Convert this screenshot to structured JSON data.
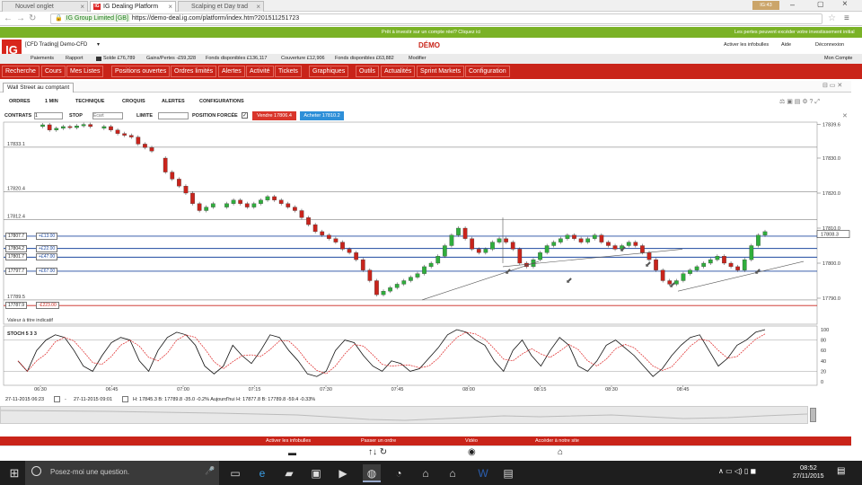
{
  "browser": {
    "tabs": [
      {
        "label": "Nouvel onglet",
        "active": false
      },
      {
        "label": "IG Dealing Platform",
        "active": true
      },
      {
        "label": "Scalping et Day trad",
        "active": false
      }
    ],
    "url": "https://demo-deal.ig.com/platform/index.htm?201511251723",
    "site_badge": "IG Group Limited [GB]",
    "user_badge": "IG:43"
  },
  "green_bar": {
    "center": "Prêt à investir sur un compte réel? Cliquez ici",
    "right": "Les pertes peuvent excéder votre investissement initial"
  },
  "header": {
    "account": "[CFD Trading] Demo-CFD",
    "mode": "DÉMO",
    "links": [
      "Activer les infobulles",
      "Aide",
      "Déconnexion"
    ]
  },
  "account_bar": {
    "items": [
      "Paiements",
      "Rapport"
    ],
    "balance": "Solde £76,789",
    "pnl": "Gains/Pertes -£59,328",
    "funds": "Fonds disponibles £136,117",
    "margin": "Couverture £12,906",
    "available": "Fonds disponibles £63,882",
    "modify": "Modifier",
    "my_account": "Mon Compte"
  },
  "menu": [
    "Recherche",
    "Cours",
    "Mes Listes",
    "Positions ouvertes",
    "Ordres limités",
    "Alertes",
    "Activité",
    "Tickets",
    "Graphiques",
    "Outils",
    "Actualités",
    "Sprint Markets",
    "Configuration"
  ],
  "window": {
    "title": "Wall Street au comptant"
  },
  "toolbar": {
    "items": [
      "ORDRES",
      "1 MIN",
      "TECHNIQUE",
      "CROQUIS",
      "ALERTES",
      "CONFIGURATIONS"
    ],
    "contracts_label": "CONTRATS",
    "contracts_value": "1",
    "stop_label": "STOP",
    "stop_placeholder": "Ecart",
    "limit_label": "LIMITE",
    "forced_label": "POSITION FORCÉE",
    "sell": "Vendre 17806.4",
    "buy": "Acheter 17810.2"
  },
  "chart": {
    "price_ticks": [
      "17839.6",
      "17830.0",
      "17820.0",
      "17810.0",
      "17808.3",
      "17800.0",
      "17790.0"
    ],
    "left_levels": [
      "17833.1",
      "17820.4",
      "17812.4",
      "17789.5"
    ],
    "positions": [
      {
        "price": "17807.7",
        "pnl": "+£13.00"
      },
      {
        "price": "17804.2",
        "pnl": "+£22.00"
      },
      {
        "price": "17801.7",
        "pnl": "+£47.00"
      },
      {
        "price": "17797.7",
        "pnl": "+£67.00"
      },
      {
        "price": "17787.9",
        "pnl": "-£223.00"
      }
    ],
    "value_label": "Valeur à titre indicatif",
    "stoch_label": "STOCH 5 3 3",
    "stoch_ticks": [
      "100",
      "80",
      "60",
      "40",
      "20",
      "0"
    ],
    "time_ticks": [
      "06:30",
      "06:45",
      "07:00",
      "07:15",
      "07:30",
      "07:45",
      "08:00",
      "08:15",
      "08:30",
      "08:45"
    ],
    "colors": {
      "up": "#2fae3c",
      "down": "#c9241c"
    }
  },
  "date_bar": {
    "from": "27-11-2015 06:23",
    "to": "27-11-2015 09:01",
    "stats": "H: 17845.3 B: 17789.8 -35.0 -0.2% Aujourd'hui H: 17877.8 B: 17789.8 -59.4 -0.33%"
  },
  "bottom_bar": [
    "Activer les infobulles",
    "Passer un ordre",
    "Vidéo",
    "Accéder à notre site"
  ],
  "taskbar": {
    "search": "Posez-moi une question.",
    "time": "08:52",
    "date": "27/11/2015"
  }
}
